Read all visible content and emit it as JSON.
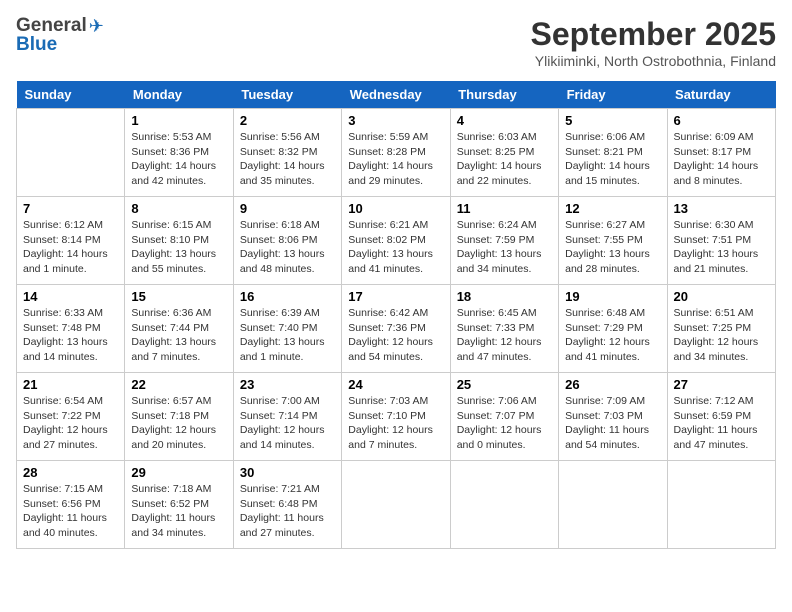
{
  "header": {
    "logo_general": "General",
    "logo_blue": "Blue",
    "month": "September 2025",
    "location": "Ylikiiminki, North Ostrobothnia, Finland"
  },
  "days": [
    "Sunday",
    "Monday",
    "Tuesday",
    "Wednesday",
    "Thursday",
    "Friday",
    "Saturday"
  ],
  "weeks": [
    [
      {
        "date": "",
        "sunrise": "",
        "sunset": "",
        "daylight": ""
      },
      {
        "date": "1",
        "sunrise": "Sunrise: 5:53 AM",
        "sunset": "Sunset: 8:36 PM",
        "daylight": "Daylight: 14 hours and 42 minutes."
      },
      {
        "date": "2",
        "sunrise": "Sunrise: 5:56 AM",
        "sunset": "Sunset: 8:32 PM",
        "daylight": "Daylight: 14 hours and 35 minutes."
      },
      {
        "date": "3",
        "sunrise": "Sunrise: 5:59 AM",
        "sunset": "Sunset: 8:28 PM",
        "daylight": "Daylight: 14 hours and 29 minutes."
      },
      {
        "date": "4",
        "sunrise": "Sunrise: 6:03 AM",
        "sunset": "Sunset: 8:25 PM",
        "daylight": "Daylight: 14 hours and 22 minutes."
      },
      {
        "date": "5",
        "sunrise": "Sunrise: 6:06 AM",
        "sunset": "Sunset: 8:21 PM",
        "daylight": "Daylight: 14 hours and 15 minutes."
      },
      {
        "date": "6",
        "sunrise": "Sunrise: 6:09 AM",
        "sunset": "Sunset: 8:17 PM",
        "daylight": "Daylight: 14 hours and 8 minutes."
      }
    ],
    [
      {
        "date": "7",
        "sunrise": "Sunrise: 6:12 AM",
        "sunset": "Sunset: 8:14 PM",
        "daylight": "Daylight: 14 hours and 1 minute."
      },
      {
        "date": "8",
        "sunrise": "Sunrise: 6:15 AM",
        "sunset": "Sunset: 8:10 PM",
        "daylight": "Daylight: 13 hours and 55 minutes."
      },
      {
        "date": "9",
        "sunrise": "Sunrise: 6:18 AM",
        "sunset": "Sunset: 8:06 PM",
        "daylight": "Daylight: 13 hours and 48 minutes."
      },
      {
        "date": "10",
        "sunrise": "Sunrise: 6:21 AM",
        "sunset": "Sunset: 8:02 PM",
        "daylight": "Daylight: 13 hours and 41 minutes."
      },
      {
        "date": "11",
        "sunrise": "Sunrise: 6:24 AM",
        "sunset": "Sunset: 7:59 PM",
        "daylight": "Daylight: 13 hours and 34 minutes."
      },
      {
        "date": "12",
        "sunrise": "Sunrise: 6:27 AM",
        "sunset": "Sunset: 7:55 PM",
        "daylight": "Daylight: 13 hours and 28 minutes."
      },
      {
        "date": "13",
        "sunrise": "Sunrise: 6:30 AM",
        "sunset": "Sunset: 7:51 PM",
        "daylight": "Daylight: 13 hours and 21 minutes."
      }
    ],
    [
      {
        "date": "14",
        "sunrise": "Sunrise: 6:33 AM",
        "sunset": "Sunset: 7:48 PM",
        "daylight": "Daylight: 13 hours and 14 minutes."
      },
      {
        "date": "15",
        "sunrise": "Sunrise: 6:36 AM",
        "sunset": "Sunset: 7:44 PM",
        "daylight": "Daylight: 13 hours and 7 minutes."
      },
      {
        "date": "16",
        "sunrise": "Sunrise: 6:39 AM",
        "sunset": "Sunset: 7:40 PM",
        "daylight": "Daylight: 13 hours and 1 minute."
      },
      {
        "date": "17",
        "sunrise": "Sunrise: 6:42 AM",
        "sunset": "Sunset: 7:36 PM",
        "daylight": "Daylight: 12 hours and 54 minutes."
      },
      {
        "date": "18",
        "sunrise": "Sunrise: 6:45 AM",
        "sunset": "Sunset: 7:33 PM",
        "daylight": "Daylight: 12 hours and 47 minutes."
      },
      {
        "date": "19",
        "sunrise": "Sunrise: 6:48 AM",
        "sunset": "Sunset: 7:29 PM",
        "daylight": "Daylight: 12 hours and 41 minutes."
      },
      {
        "date": "20",
        "sunrise": "Sunrise: 6:51 AM",
        "sunset": "Sunset: 7:25 PM",
        "daylight": "Daylight: 12 hours and 34 minutes."
      }
    ],
    [
      {
        "date": "21",
        "sunrise": "Sunrise: 6:54 AM",
        "sunset": "Sunset: 7:22 PM",
        "daylight": "Daylight: 12 hours and 27 minutes."
      },
      {
        "date": "22",
        "sunrise": "Sunrise: 6:57 AM",
        "sunset": "Sunset: 7:18 PM",
        "daylight": "Daylight: 12 hours and 20 minutes."
      },
      {
        "date": "23",
        "sunrise": "Sunrise: 7:00 AM",
        "sunset": "Sunset: 7:14 PM",
        "daylight": "Daylight: 12 hours and 14 minutes."
      },
      {
        "date": "24",
        "sunrise": "Sunrise: 7:03 AM",
        "sunset": "Sunset: 7:10 PM",
        "daylight": "Daylight: 12 hours and 7 minutes."
      },
      {
        "date": "25",
        "sunrise": "Sunrise: 7:06 AM",
        "sunset": "Sunset: 7:07 PM",
        "daylight": "Daylight: 12 hours and 0 minutes."
      },
      {
        "date": "26",
        "sunrise": "Sunrise: 7:09 AM",
        "sunset": "Sunset: 7:03 PM",
        "daylight": "Daylight: 11 hours and 54 minutes."
      },
      {
        "date": "27",
        "sunrise": "Sunrise: 7:12 AM",
        "sunset": "Sunset: 6:59 PM",
        "daylight": "Daylight: 11 hours and 47 minutes."
      }
    ],
    [
      {
        "date": "28",
        "sunrise": "Sunrise: 7:15 AM",
        "sunset": "Sunset: 6:56 PM",
        "daylight": "Daylight: 11 hours and 40 minutes."
      },
      {
        "date": "29",
        "sunrise": "Sunrise: 7:18 AM",
        "sunset": "Sunset: 6:52 PM",
        "daylight": "Daylight: 11 hours and 34 minutes."
      },
      {
        "date": "30",
        "sunrise": "Sunrise: 7:21 AM",
        "sunset": "Sunset: 6:48 PM",
        "daylight": "Daylight: 11 hours and 27 minutes."
      },
      {
        "date": "",
        "sunrise": "",
        "sunset": "",
        "daylight": ""
      },
      {
        "date": "",
        "sunrise": "",
        "sunset": "",
        "daylight": ""
      },
      {
        "date": "",
        "sunrise": "",
        "sunset": "",
        "daylight": ""
      },
      {
        "date": "",
        "sunrise": "",
        "sunset": "",
        "daylight": ""
      }
    ]
  ]
}
